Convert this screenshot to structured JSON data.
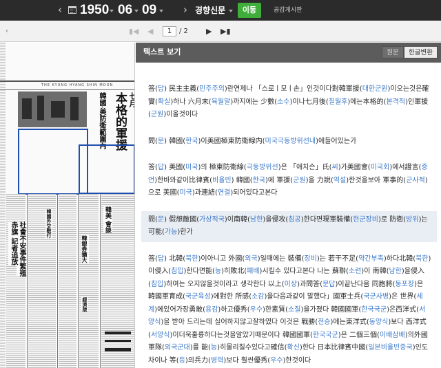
{
  "topbar": {
    "year": "1950",
    "month": "06",
    "day": "09",
    "newspaper": "경향신문",
    "go_label": "이동",
    "board_label": "공감게시판"
  },
  "pager": {
    "current_page": "1",
    "total_pages": "/ 2"
  },
  "scan": {
    "masthead": "THE KYUNG HYANG SHIN MOON",
    "headline_main": "本格的軍援",
    "headline_sub": "韓國‧美防衛範圍內",
    "headline_top": "七月",
    "col_heads": [
      "韓國外交敷行",
      "社會不安事件繁殖",
      "赤旗 記者追放",
      "韓銀券擴大",
      "韓美 會談"
    ],
    "small_label": "經濟版"
  },
  "panel": {
    "title": "텍스트 보기",
    "tab_original": "원문",
    "tab_hangul": "한글변환"
  },
  "paragraphs": [
    {
      "highlight": false,
      "segments": [
        [
          "答(",
          "t"
        ],
        [
          "답",
          "r"
        ],
        [
          ") 民主主義(",
          "t"
        ],
        [
          "민주주의",
          "r"
        ],
        [
          ")란연제나 「스로ㅣ모ㅣ손」인것이다對韓軍援(",
          "t"
        ],
        [
          "대한군원",
          "r"
        ],
        [
          ")이오는것은確實(",
          "t"
        ],
        [
          "확실",
          "r"
        ],
        [
          ")하나 六月末(",
          "t"
        ],
        [
          "육월말",
          "r"
        ],
        [
          ")까지에는 少數(",
          "t"
        ],
        [
          "소수",
          "r"
        ],
        [
          ")이나七月後(",
          "t"
        ],
        [
          "칠월후",
          "r"
        ],
        [
          ")에는本格的(",
          "t"
        ],
        [
          "본격적",
          "r"
        ],
        [
          ")인軍援(",
          "t"
        ],
        [
          "군원",
          "r"
        ],
        [
          ")이올것이다",
          "t"
        ]
      ]
    },
    {
      "highlight": false,
      "segments": [
        [
          "問(",
          "t"
        ],
        [
          "문",
          "r"
        ],
        [
          ") 韓國(",
          "t"
        ],
        [
          "한국",
          "r"
        ],
        [
          ")이美國極東防衛線内(",
          "t"
        ],
        [
          "미국극동방위선내",
          "r"
        ],
        [
          ")에들어있는가",
          "t"
        ]
      ]
    },
    {
      "highlight": false,
      "segments": [
        [
          "答(",
          "t"
        ],
        [
          "답",
          "r"
        ],
        [
          ") 美國(",
          "t"
        ],
        [
          "미국",
          "r"
        ],
        [
          ")의 極東防衛線(",
          "t"
        ],
        [
          "극동방위선",
          "r"
        ],
        [
          ")은 「애치슨」氏(",
          "t"
        ],
        [
          "씨",
          "r"
        ],
        [
          ")가美國會(",
          "t"
        ],
        [
          "미국회",
          "r"
        ],
        [
          ")에서證言(",
          "t"
        ],
        [
          "증언",
          "r"
        ],
        [
          ")한바와같이比律賓(",
          "t"
        ],
        [
          "비율빈",
          "r"
        ],
        [
          ") 韓國(",
          "t"
        ],
        [
          "한국",
          "r"
        ],
        [
          ")에 軍援(",
          "t"
        ],
        [
          "군원",
          "r"
        ],
        [
          ")을 力說(",
          "t"
        ],
        [
          "역설",
          "r"
        ],
        [
          ")한것을보아 軍事的(",
          "t"
        ],
        [
          "군사적",
          "r"
        ],
        [
          ")으로 美國(",
          "t"
        ],
        [
          "미국",
          "r"
        ],
        [
          ")과連結(",
          "t"
        ],
        [
          "연결",
          "r"
        ],
        [
          ")되어있다고본다",
          "t"
        ]
      ]
    },
    {
      "highlight": true,
      "segments": [
        [
          "問(",
          "t"
        ],
        [
          "문",
          "r"
        ],
        [
          ") 假想敵國(",
          "t"
        ],
        [
          "가상적국",
          "r"
        ],
        [
          ")이南韓(",
          "t"
        ],
        [
          "남한",
          "r"
        ],
        [
          ")을侵攻(",
          "t"
        ],
        [
          "침공",
          "r"
        ],
        [
          ")한다면現軍裝備(",
          "t"
        ],
        [
          "현군장비",
          "r"
        ],
        [
          ")로 防衛(",
          "t"
        ],
        [
          "방위",
          "r"
        ],
        [
          ")는可能(",
          "t"
        ],
        [
          "가능",
          "r"
        ],
        [
          ")한가",
          "t"
        ]
      ]
    },
    {
      "highlight": false,
      "segments": [
        [
          "答(",
          "t"
        ],
        [
          "답",
          "r"
        ],
        [
          ") 北韓(",
          "t"
        ],
        [
          "북한",
          "r"
        ],
        [
          ")이아니고 外國(",
          "t"
        ],
        [
          "외국",
          "r"
        ],
        [
          ")일때에는 裝備(",
          "t"
        ],
        [
          "장비",
          "r"
        ],
        [
          ")는 若干不足(",
          "t"
        ],
        [
          "약간부족",
          "r"
        ],
        [
          ")하다北韓(",
          "t"
        ],
        [
          "북한",
          "r"
        ],
        [
          ")이侵入(",
          "t"
        ],
        [
          "침입",
          "r"
        ],
        [
          ")한다면能(",
          "t"
        ],
        [
          "능",
          "r"
        ],
        [
          ")히敗北(",
          "t"
        ],
        [
          "패배",
          "r"
        ],
        [
          ")시킬수 있다고본다 나는 蘇聯(",
          "t"
        ],
        [
          "소련",
          "r"
        ],
        [
          ")이 南韓(",
          "t"
        ],
        [
          "남한",
          "r"
        ],
        [
          ")을侵入(",
          "t"
        ],
        [
          "침입",
          "r"
        ],
        [
          ")하여는 오지않을것이라고 생각한다 以上(",
          "t"
        ],
        [
          "이상",
          "r"
        ],
        [
          ")과問答(",
          "t"
        ],
        [
          "문답",
          "r"
        ],
        [
          ")이끝난다음 同胞將(",
          "t"
        ],
        [
          "동포장",
          "r"
        ],
        [
          ")은 韓國軍育成(",
          "t"
        ],
        [
          "국군육성",
          "r"
        ],
        [
          ")에對한 所感(",
          "t"
        ],
        [
          "소감",
          "r"
        ],
        [
          ")을다음과같이 말했다」國軍士兵(",
          "t"
        ],
        [
          "국군사병",
          "r"
        ],
        [
          ")은 世界(",
          "t"
        ],
        [
          "세계",
          "r"
        ],
        [
          ")에있어가장勇敢(",
          "t"
        ],
        [
          "용감",
          "r"
        ],
        [
          ")하고優秀(",
          "t"
        ],
        [
          "우수",
          "r"
        ],
        [
          ")한素質(",
          "t"
        ],
        [
          "소질",
          "r"
        ],
        [
          ")을가졌다 韓國國軍(",
          "t"
        ],
        [
          "한국국군",
          "r"
        ],
        [
          ")은西洋式(",
          "t"
        ],
        [
          "서양식",
          "r"
        ],
        [
          ")을 받아 드리는데 실어하지않고잘하였다 이것은 戰勝(",
          "t"
        ],
        [
          "전승",
          "r"
        ],
        [
          ")에는東洋式(",
          "t"
        ],
        [
          "동양식",
          "r"
        ],
        [
          ")보다 西洋式(",
          "t"
        ],
        [
          "서양식",
          "r"
        ],
        [
          ")이더욱훌륭하다는것을알았기때문이다 韓國國軍(",
          "t"
        ],
        [
          "한국국군",
          "r"
        ],
        [
          ")은 二個三個(",
          "t"
        ],
        [
          "이배삼배",
          "r"
        ],
        [
          ")의外國軍隊(",
          "t"
        ],
        [
          "외국군대",
          "r"
        ],
        [
          ")를 能(",
          "t"
        ],
        [
          "능",
          "r"
        ],
        [
          ")히물리칠수있다고確信(",
          "t"
        ],
        [
          "확신",
          "r"
        ],
        [
          ")한다 日本比律賓中國(",
          "t"
        ],
        [
          "일본비율빈중국",
          "r"
        ],
        [
          ")인도차이나 等(",
          "t"
        ],
        [
          "등",
          "r"
        ],
        [
          ")의兵力(",
          "t"
        ],
        [
          "병력",
          "r"
        ],
        [
          ")보다 훨씬優秀(",
          "t"
        ],
        [
          "우수",
          "r"
        ],
        [
          ")한것이다",
          "t"
        ]
      ]
    }
  ],
  "colors": {
    "topbar_bg": "#2b2b2b",
    "go_button": "#3fae3a",
    "reading_blue": "#3a78c9",
    "frame_blue": "#1f4fb0",
    "panel_header": "#5c5c5c",
    "highlight_bg": "#e9eef4"
  },
  "icons": {
    "prev": "chevron-left-icon",
    "next": "chevron-right-icon",
    "calendar": "calendar-icon",
    "first": "first-page-icon",
    "last": "last-page-icon"
  }
}
